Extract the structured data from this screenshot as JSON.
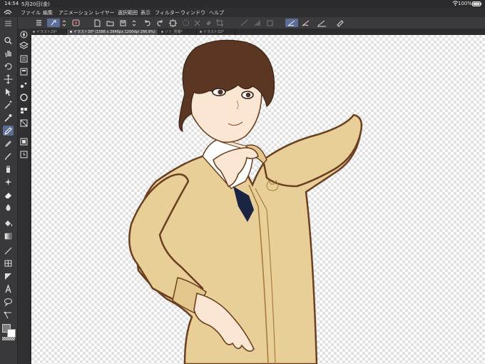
{
  "status": {
    "time": "14:54",
    "date": "5月20日(金)",
    "battery": "100%"
  },
  "menu": {
    "items": [
      "ファイル",
      "編集",
      "アニメーション",
      "レイヤー",
      "選択範囲",
      "表示",
      "フィルター",
      "ウィンドウ",
      "ヘルプ"
    ]
  },
  "tabs": [
    {
      "label": "イラスト29*",
      "active": false
    },
    {
      "label": "イラスト30* (1586 x 2646px 1200dpi 166.9%)",
      "active": true
    },
    {
      "label": "ソリ_男服*",
      "active": false
    },
    {
      "label": "イラスト32*",
      "active": false
    }
  ],
  "tools": {
    "primary": [
      "zoom-icon",
      "hand-icon",
      "rotate-icon",
      "move-icon",
      "operation-icon",
      "magic-wand-icon",
      "eyedropper-icon",
      "pen-icon",
      "pencil-icon",
      "brush-icon",
      "airbrush-icon",
      "decoration-icon",
      "eraser-icon",
      "blend-icon",
      "fill-icon",
      "gradient-icon",
      "figure-icon",
      "frame-icon",
      "ruler-icon",
      "text-icon",
      "balloon-icon",
      "correct-line-icon"
    ],
    "active": "pen-icon",
    "sub": [
      "navigator-icon",
      "layers-icon",
      "sub-tool-icon",
      "tool-property-icon",
      "brush-size-icon",
      "color-wheel-icon",
      "color-set-icon",
      "intermediate-color-icon",
      "approx-color-icon",
      "color-history-icon",
      "layer-property-icon",
      "search-layer-icon",
      "material-icon"
    ]
  },
  "colors": {
    "main": "#7f7f7f",
    "sub": "#ffffff",
    "accent": "#5c6d96",
    "sweater": "#e8cf98",
    "hair": "#5b3622",
    "skin": "#fae6d2",
    "outline": "#6b3f20",
    "tie": "#1c2444"
  }
}
